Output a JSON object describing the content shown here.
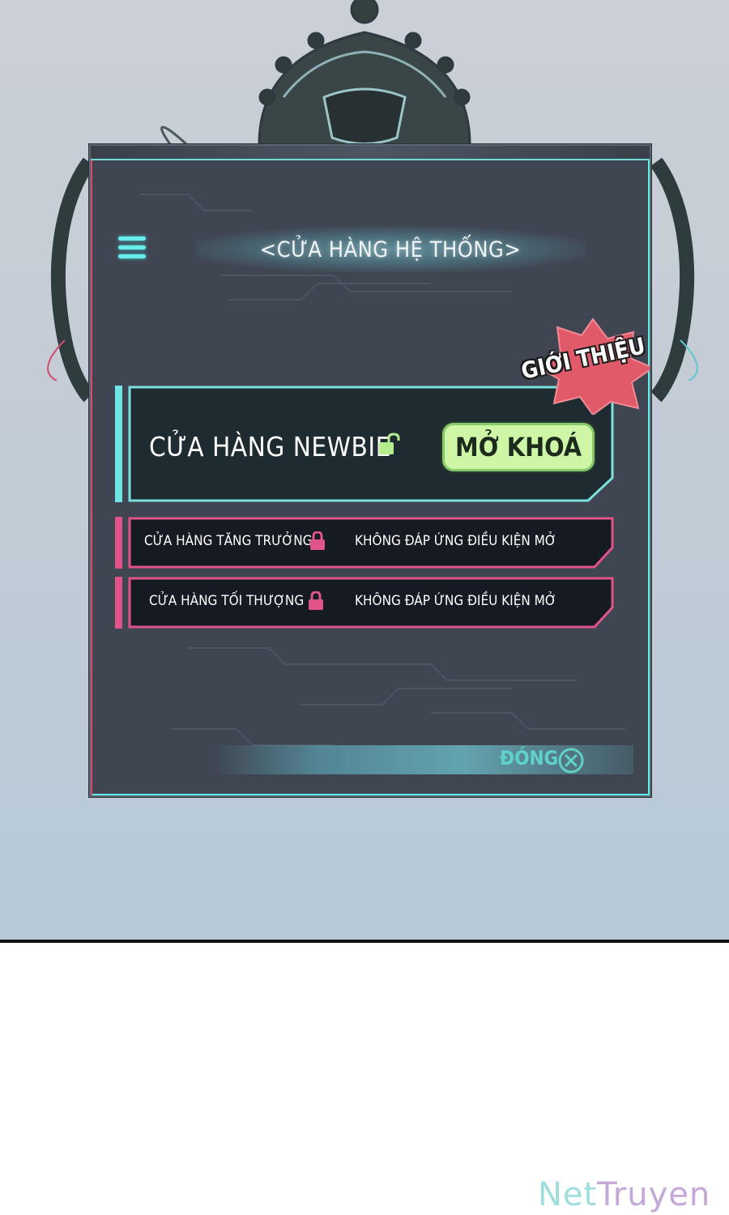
{
  "header": {
    "title": "<CỬA HÀNG HỆ THỐNG>"
  },
  "badge": {
    "label": "GIỚI THIỆU"
  },
  "shops": {
    "newbie": {
      "name": "CỬA HÀNG NEWBIE",
      "action_label": "MỞ KHOÁ",
      "lock_icon": "unlocked-padlock-icon"
    },
    "locked": [
      {
        "name": "CỬA HÀNG TĂNG TRƯỞNG",
        "status": "KHÔNG ĐÁP ỨNG ĐIỀU KIỆN MỞ",
        "lock_icon": "padlock-icon"
      },
      {
        "name": "CỬA HÀNG TỐI THƯỢNG",
        "status": "KHÔNG ĐÁP ỨNG ĐIỀU KIỆN MỞ",
        "lock_icon": "padlock-icon"
      }
    ]
  },
  "footer": {
    "close_label": "ĐÓNG"
  },
  "watermark": {
    "part1": "Net",
    "part2": "Truyen"
  },
  "colors": {
    "panel_bg": "#404552",
    "accent_cyan": "#6fe6e2",
    "accent_pink": "#e0548a",
    "unlock_button_bg": "#cdf7a6",
    "badge_red": "#e05a6a"
  }
}
